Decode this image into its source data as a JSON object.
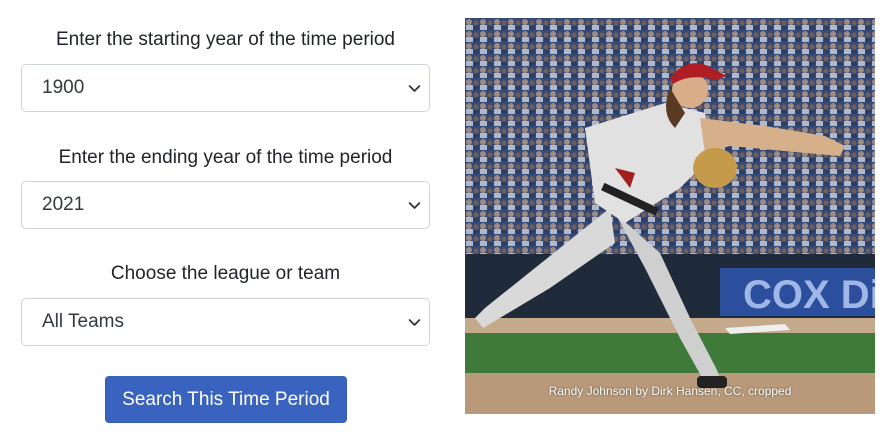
{
  "form": {
    "start_year": {
      "label": "Enter the starting year of the time period",
      "value": "1900"
    },
    "end_year": {
      "label": "Enter the ending year of the time period",
      "value": "2021"
    },
    "league": {
      "label": "Choose the league or team",
      "value": "All Teams"
    },
    "search_label": "Search This Time Period"
  },
  "photo": {
    "caption": "Randy Johnson by Dirk Hansen, CC, cropped",
    "wall_text": "COX Di"
  },
  "colors": {
    "button": "#3a63bf",
    "border": "#ced4da"
  }
}
